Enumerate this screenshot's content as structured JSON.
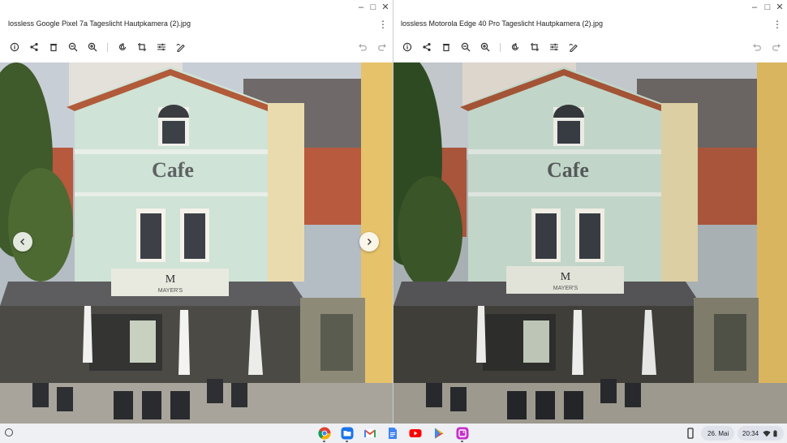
{
  "windows": [
    {
      "title": "lossless Google Pixel 7a Tageslicht Hautpkamera (2).jpg",
      "controls": {
        "minimize": "–",
        "maximize": "□",
        "close": "✕"
      },
      "menu_icon": "⋮",
      "photo_sign": "Cafe",
      "photo_logo": "M",
      "photo_shop": "MAYER'S"
    },
    {
      "title": "lossless Motorola Edge 40 Pro Tageslicht Hautpkamera (2).jpg",
      "controls": {
        "minimize": "–",
        "maximize": "□",
        "close": "✕"
      },
      "menu_icon": "⋮",
      "photo_sign": "Cafe",
      "photo_logo": "M",
      "photo_shop": "MAYER'S"
    }
  ],
  "toolbar_icons": [
    "info-icon",
    "share-icon",
    "delete-icon",
    "zoom-out-icon",
    "zoom-in-icon",
    "rotate-icon",
    "crop-icon",
    "adjust-icon",
    "annotate-icon",
    "undo-icon",
    "redo-icon"
  ],
  "shelf": {
    "apps": [
      "chrome-icon",
      "files-icon",
      "gmail-icon",
      "docs-icon",
      "youtube-icon",
      "play-store-icon",
      "gallery-icon"
    ],
    "date": "26. Mai",
    "time": "20:34"
  },
  "colors": {
    "accent": "#1a73e8",
    "facade": "#cfe3d6",
    "roof": "#b85a3e"
  }
}
